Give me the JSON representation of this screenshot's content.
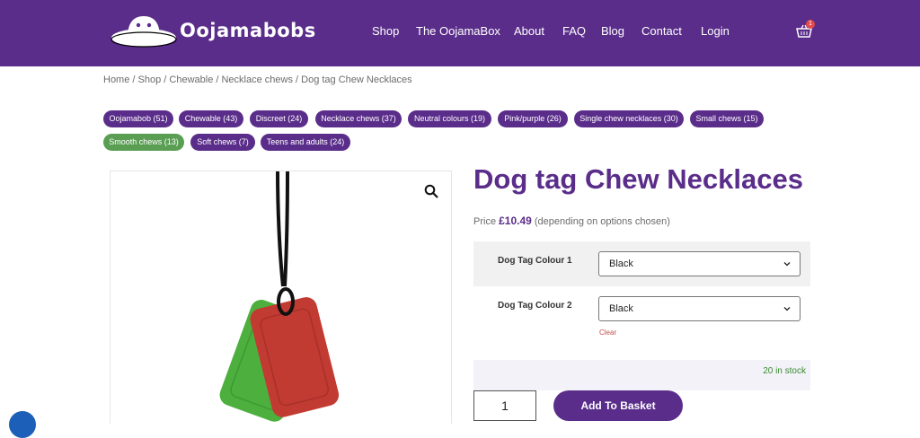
{
  "header": {
    "brand": "Oojamabobs",
    "nav": [
      "Shop",
      "The OojamaBox",
      "About",
      "FAQ",
      "Blog",
      "Contact",
      "Login"
    ],
    "cart_count": "1",
    "bg_color": "#5a2d8a"
  },
  "breadcrumb": {
    "items": [
      "Home",
      "Shop",
      "Chewable",
      "Necklace chews",
      "Dog tag Chew Necklaces"
    ],
    "separator": " / "
  },
  "tags": [
    "Oojamabob (51)",
    "Chewable (43)",
    "Discreet (24)",
    "Necklace chews (37)",
    "Neutral colours (19)",
    "Pink/purple (26)",
    "Single chew necklaces (30)",
    "Small chews (15)",
    "Smooth chews (13)",
    "Soft chews (7)",
    "Teens and adults (24)"
  ],
  "product": {
    "title": "Dog tag Chew Necklaces",
    "price_prefix": "Price",
    "price": "£10.49",
    "price_suffix": "(depending on options chosen)",
    "options": [
      {
        "label": "Dog Tag Colour 1",
        "value": "Black"
      },
      {
        "label": "Dog Tag Colour 2",
        "value": "Black"
      }
    ],
    "clear_label": "Clear",
    "stock": "20 in stock",
    "quantity": "1",
    "add_button": "Add To Basket"
  },
  "icons": {
    "zoom": "magnifier-icon",
    "cart": "basket-icon",
    "accessibility": "accessibility-icon"
  }
}
